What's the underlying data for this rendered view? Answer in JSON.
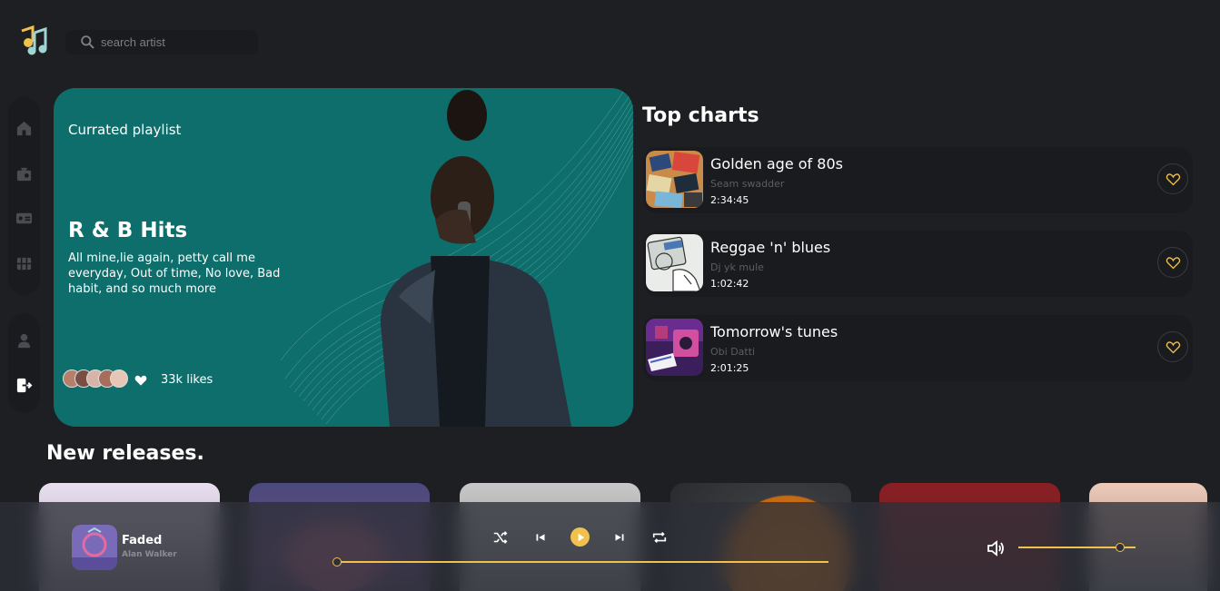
{
  "search": {
    "placeholder": "search artist"
  },
  "sidebar": {
    "items": [
      {
        "icon": "home-icon"
      },
      {
        "icon": "radio-icon"
      },
      {
        "icon": "video-icon"
      },
      {
        "icon": "grid-icon"
      },
      {
        "icon": "profile-icon"
      },
      {
        "icon": "logout-icon"
      }
    ]
  },
  "hero": {
    "subtitle": "Currated playlist",
    "title": "R & B Hits",
    "description": "All mine,lie again, petty call me everyday, Out of time, No love, Bad habit, and so much more",
    "likes": "33k likes"
  },
  "top_charts": {
    "title": "Top charts",
    "items": [
      {
        "name": "Golden age of 80s",
        "artist": "Seam swadder",
        "duration": "2:34:45"
      },
      {
        "name": "Reggae 'n' blues",
        "artist": "Dj yk mule",
        "duration": "1:02:42"
      },
      {
        "name": "Tomorrow's tunes",
        "artist": "Obi Datti",
        "duration": "2:01:25"
      }
    ]
  },
  "new_releases": {
    "title": "New releases."
  },
  "player": {
    "track_title": "Faded",
    "track_artist": "Alan Walker",
    "progress": 0.0,
    "volume": 0.83
  },
  "colors": {
    "accent": "#f0c14b",
    "hero_bg": "#0e6e6b",
    "background": "#1e1f23",
    "card_bg": "#1a1b1f"
  }
}
